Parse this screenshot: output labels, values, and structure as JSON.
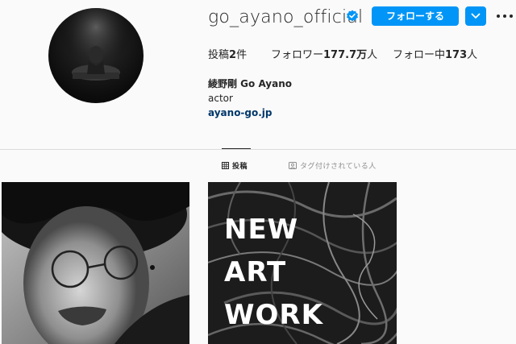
{
  "profile": {
    "username": "go_ayano_official",
    "verified": true,
    "follow_label": "フォローする",
    "stats": {
      "posts_prefix": "投稿",
      "posts_count": "2",
      "posts_suffix": "件",
      "followers_prefix": "フォロワー",
      "followers_count": "177.7万",
      "followers_suffix": "人",
      "following_prefix": "フォロー中",
      "following_count": "173",
      "following_suffix": "人"
    },
    "full_name": "綾野剛 Go Ayano",
    "bio": "actor",
    "link": "ayano-go.jp"
  },
  "tabs": {
    "posts_label": "投稿",
    "tagged_label": "タグ付けされている人"
  },
  "posts": {
    "second_post_lines": [
      "NEW",
      "ART",
      "WORK"
    ]
  },
  "colors": {
    "accent": "#0095f6",
    "link": "#00376b",
    "text": "#262626",
    "muted": "#8e8e8e",
    "background": "#fafafa"
  }
}
